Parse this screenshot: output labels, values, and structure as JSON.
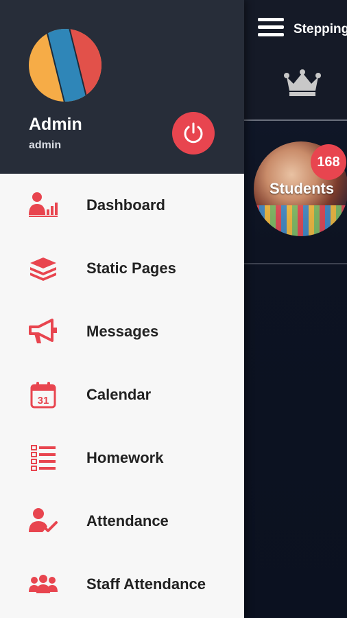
{
  "app": {
    "title": "Stepping"
  },
  "header_badge": {
    "label": "Students",
    "count": "168"
  },
  "user": {
    "name": "Admin",
    "role": "admin"
  },
  "menu": [
    {
      "label": "Dashboard",
      "icon": "dashboard-icon"
    },
    {
      "label": "Static Pages",
      "icon": "stack-icon"
    },
    {
      "label": "Messages",
      "icon": "megaphone-icon"
    },
    {
      "label": "Calendar",
      "icon": "calendar-icon",
      "day": "31"
    },
    {
      "label": "Homework",
      "icon": "checklist-icon"
    },
    {
      "label": "Attendance",
      "icon": "user-check-icon"
    },
    {
      "label": "Staff Attendance",
      "icon": "group-icon"
    }
  ],
  "colors": {
    "accent": "#e8454f",
    "header": "#272d39",
    "drawer_bg": "#f7f7f7"
  }
}
